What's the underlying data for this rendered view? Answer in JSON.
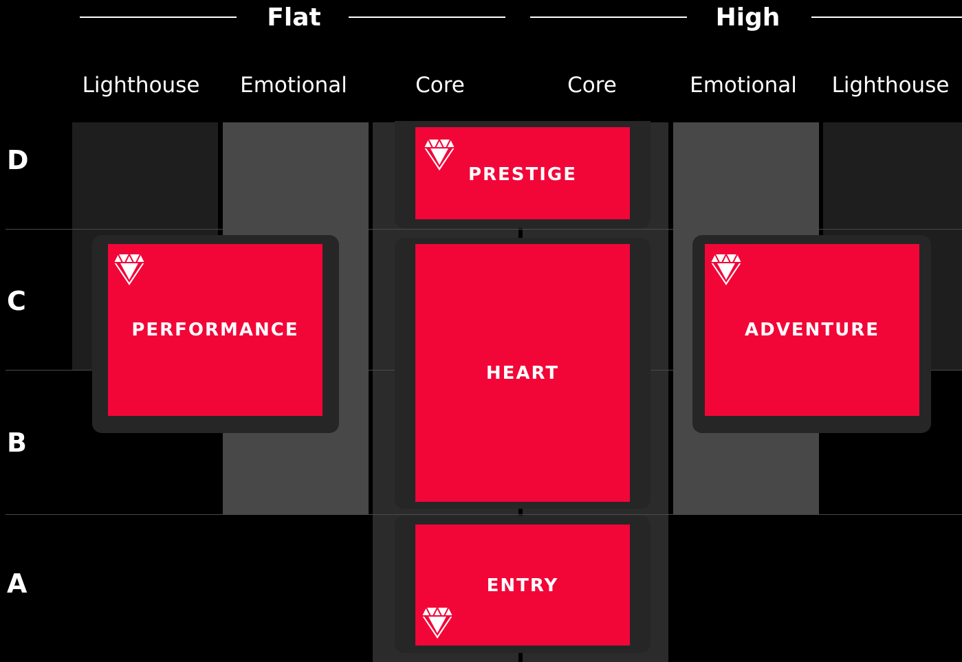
{
  "groups": [
    {
      "title": "Flat"
    },
    {
      "title": "High"
    }
  ],
  "columns": [
    "Lighthouse",
    "Emotional",
    "Core",
    "Core",
    "Emotional",
    "Lighthouse"
  ],
  "rows": [
    "D",
    "C",
    "B",
    "A"
  ],
  "segments": [
    {
      "label": "PRESTIGE",
      "icon": "diamond-icon"
    },
    {
      "label": "PERFORMANCE",
      "icon": "diamond-icon"
    },
    {
      "label": "HEART"
    },
    {
      "label": "ADVENTURE",
      "icon": "diamond-icon"
    },
    {
      "label": "ENTRY",
      "icon": "diamond-icon"
    }
  ],
  "colors": {
    "background": "#000000",
    "segment": "#f20638",
    "lighthouse_band": "#1e1e1e",
    "emotional_band": "#484848",
    "core_band": "#2b2b2b",
    "box_shadow": "#262626"
  }
}
